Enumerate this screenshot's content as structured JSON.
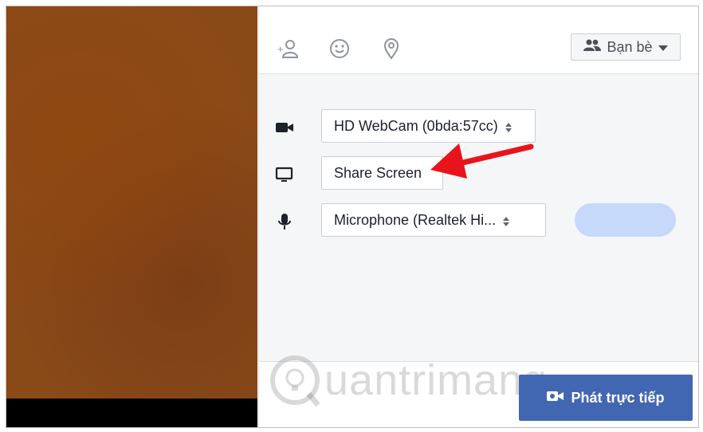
{
  "toolbar": {
    "icons": [
      "tag-friends-icon",
      "feeling-icon",
      "location-icon"
    ],
    "audience_label": "Bạn bè"
  },
  "settings": {
    "camera_value": "HD WebCam (0bda:57cc)",
    "share_screen_label": "Share Screen",
    "microphone_value": "Microphone (Realtek Hi..."
  },
  "footer": {
    "watermark_text": "uantrimang",
    "go_live_label": "Phát trực tiếp"
  },
  "colors": {
    "primary": "#4267b2",
    "annotation_arrow": "#e8141b",
    "settings_bg": "#f5f6f7"
  }
}
